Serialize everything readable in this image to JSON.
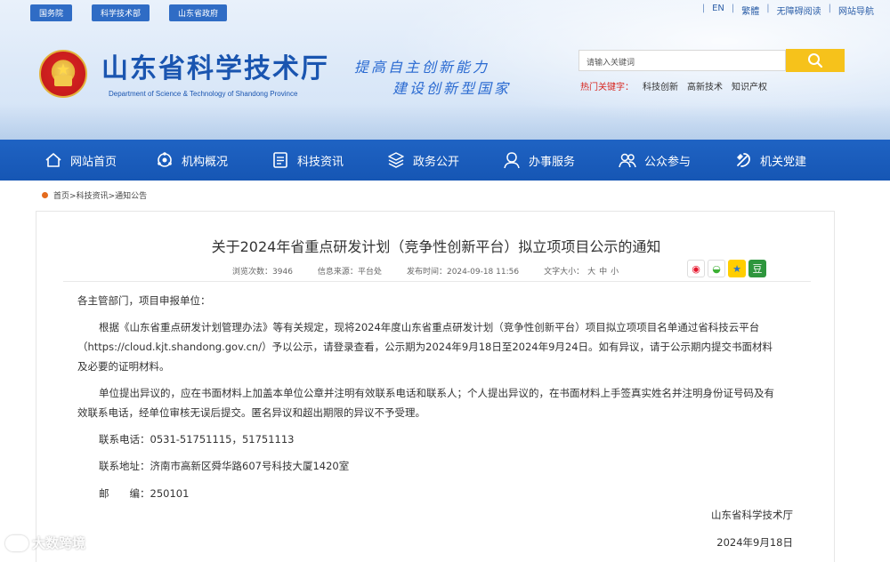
{
  "top_links": [
    "国务院",
    "科学技术部",
    "山东省政府"
  ],
  "lang_links": [
    "EN",
    "繁體",
    "无障碍阅读",
    "网站导航"
  ],
  "site": {
    "title": "山东省科学技术厅",
    "subtitle": "Department of Science & Technology of Shandong Province",
    "slogan_line1": "提高自主创新能力",
    "slogan_line2": "建设创新型国家"
  },
  "search": {
    "placeholder": "请输入关键词",
    "hot_label": "热门关键字：",
    "hot_keywords": [
      "科技创新",
      "高新技术",
      "知识产权"
    ]
  },
  "nav": [
    {
      "label": "网站首页",
      "icon": "home-icon"
    },
    {
      "label": "机构概况",
      "icon": "org-icon"
    },
    {
      "label": "科技资讯",
      "icon": "news-icon"
    },
    {
      "label": "政务公开",
      "icon": "layers-icon"
    },
    {
      "label": "办事服务",
      "icon": "service-icon"
    },
    {
      "label": "公众参与",
      "icon": "people-icon"
    },
    {
      "label": "机关党建",
      "icon": "party-icon"
    }
  ],
  "breadcrumb": [
    "首页",
    "科技资讯",
    "通知公告"
  ],
  "article": {
    "title": "关于2024年省重点研发计划（竞争性创新平台）拟立项项目公示的通知",
    "views_label": "浏览次数：",
    "views": "3946",
    "source_label": "信息来源：",
    "source": "平台处",
    "date_label": "发布时间：",
    "date": "2024-09-18 11:56",
    "fontsize_label": "文字大小：",
    "fontsize_options": [
      "大",
      "中",
      "小"
    ],
    "salutation": "各主管部门，项目申报单位：",
    "para1": "根据《山东省重点研发计划管理办法》等有关规定，现将2024年度山东省重点研发计划（竞争性创新平台）项目拟立项项目名单通过省科技云平台（https://cloud.kjt.shandong.gov.cn/）予以公示，请登录查看，公示期为2024年9月18日至2024年9月24日。如有异议，请于公示期内提交书面材料及必要的证明材料。",
    "para2": "单位提出异议的，应在书面材料上加盖本单位公章并注明有效联系电话和联系人；个人提出异议的，在书面材料上手签真实姓名并注明身份证号码及有效联系电话，经单位审核无误后提交。匿名异议和超出期限的异议不予受理。",
    "phone": "联系电话：0531-51751115，51751113",
    "address": "联系地址：济南市高新区舜华路607号科技大厦1420室",
    "postcode": "邮　　编：250101",
    "signature_org": "山东省科学技术厅",
    "signature_date": "2024年9月18日"
  },
  "share_icons": [
    "weibo-icon",
    "wechat-icon",
    "qzone-icon",
    "douban-icon"
  ],
  "watermark": "大数跨境",
  "colors": {
    "nav_blue": "#1a5cbc",
    "title_blue": "#1a55b0",
    "search_yellow": "#f6c21b",
    "hot_red": "#d7261f",
    "breadcrumb_dot": "#e46b1d"
  }
}
